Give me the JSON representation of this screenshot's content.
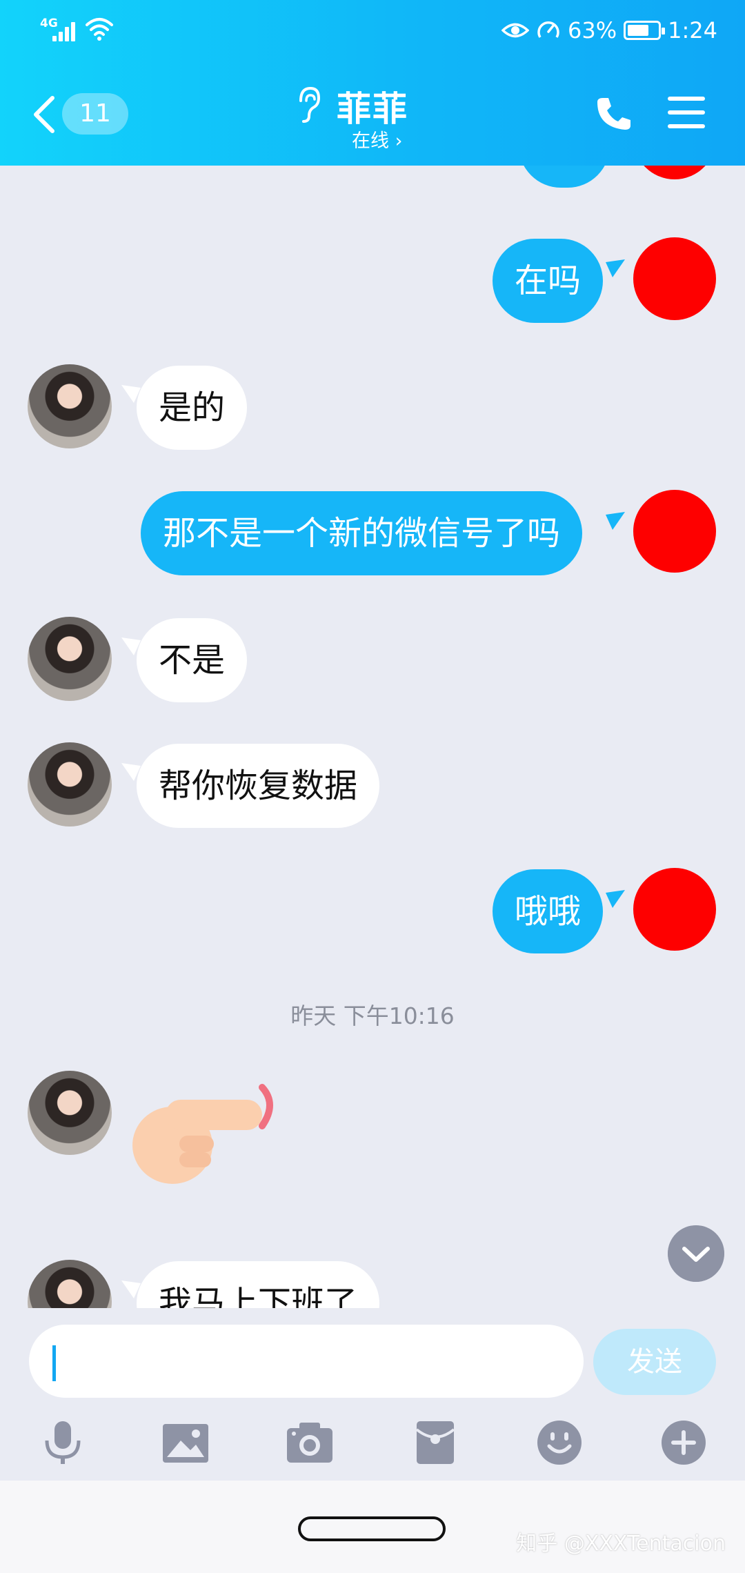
{
  "status_bar": {
    "network": "4G",
    "battery": "63%",
    "time": "1:24"
  },
  "header": {
    "unread_count": "11",
    "title": "菲菲",
    "subtitle": "在线 ›"
  },
  "messages": [
    {
      "from": "me",
      "text": "在吗"
    },
    {
      "from": "her",
      "text": "是的"
    },
    {
      "from": "me",
      "text": "那不是一个新的微信号了吗"
    },
    {
      "from": "her",
      "text": "不是"
    },
    {
      "from": "her",
      "text": "帮你恢复数据"
    },
    {
      "from": "me",
      "text": "哦哦"
    },
    {
      "from": "her",
      "text": "我马上下班了"
    }
  ],
  "timestamp": "昨天 下午10:16",
  "input": {
    "value": "",
    "send_label": "发送"
  },
  "colors": {
    "header_start": "#12d3fb",
    "header_end": "#0fa7f6",
    "my_bubble": "#16b6f8",
    "my_avatar": "#fe0000",
    "background": "#e9ebf3"
  },
  "watermark": "知乎 @XXXTentacion"
}
